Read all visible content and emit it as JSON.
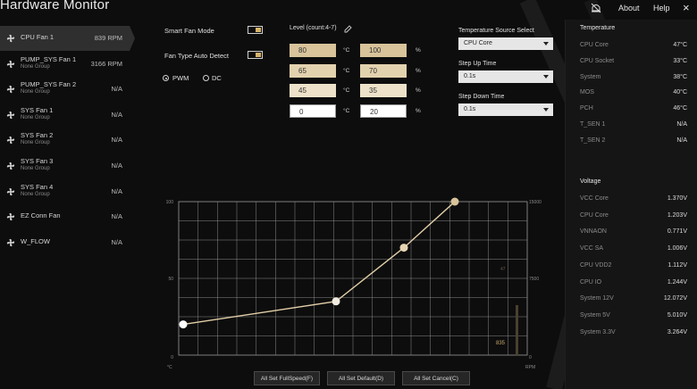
{
  "app": {
    "title": "Hardware Monitor",
    "about": "About",
    "help": "Help",
    "close": "×"
  },
  "fans": [
    {
      "name": "CPU Fan 1",
      "group": "",
      "value": "839 RPM",
      "active": true
    },
    {
      "name": "PUMP_SYS Fan 1",
      "group": "None Group",
      "value": "3166 RPM"
    },
    {
      "name": "PUMP_SYS Fan 2",
      "group": "None Group",
      "value": "N/A"
    },
    {
      "name": "SYS Fan 1",
      "group": "None Group",
      "value": "N/A"
    },
    {
      "name": "SYS Fan 2",
      "group": "None Group",
      "value": "N/A"
    },
    {
      "name": "SYS Fan 3",
      "group": "None Group",
      "value": "N/A"
    },
    {
      "name": "SYS Fan 4",
      "group": "None Group",
      "value": "N/A"
    },
    {
      "name": "EZ Conn Fan",
      "group": "",
      "value": "N/A"
    },
    {
      "name": "W_FLOW",
      "group": "",
      "value": "N/A"
    }
  ],
  "controls": {
    "smart_fan_mode": "Smart Fan Mode",
    "fan_type_auto_detect": "Fan Type Auto Detect",
    "pwm": "PWM",
    "dc": "DC",
    "level_label": "Level (count:4-7)"
  },
  "levels": [
    {
      "temp": "80",
      "temp_unit": "°C",
      "pct": "100",
      "pct_unit": "%"
    },
    {
      "temp": "65",
      "temp_unit": "°C",
      "pct": "70",
      "pct_unit": "%"
    },
    {
      "temp": "45",
      "temp_unit": "°C",
      "pct": "35",
      "pct_unit": "%"
    },
    {
      "temp": "0",
      "temp_unit": "°C",
      "pct": "20",
      "pct_unit": "%"
    }
  ],
  "level_colors": [
    "#d8c39a",
    "#e3d2ae",
    "#ede2c9",
    "#ffffff"
  ],
  "dropdowns": {
    "temp_source_label": "Temperature Source Select",
    "temp_source_value": "CPU Core",
    "step_up_label": "Step Up Time",
    "step_up_value": "0.1s",
    "step_down_label": "Step Down Time",
    "step_down_value": "0.1s"
  },
  "chart_data": {
    "type": "line",
    "x": [
      0,
      45,
      65,
      80
    ],
    "y": [
      20,
      35,
      70,
      100
    ],
    "xlim": [
      0,
      100
    ],
    "ylim": [
      0,
      100
    ],
    "y_ticks_left": [
      "100",
      "50",
      "0"
    ],
    "y_ticks_right": [
      "15000",
      "7500",
      "0"
    ],
    "x_unit_label": "°C",
    "right_unit_label": "RPM",
    "current_rpm_label": "835",
    "current_temp_label": "47",
    "grid": true,
    "line_color": "#e3cfa8"
  },
  "buttons": {
    "full_speed": "All Set FullSpeed(F)",
    "default": "All Set Default(D)",
    "cancel": "All Set Cancel(C)"
  },
  "temperature": {
    "title": "Temperature",
    "items": [
      {
        "label": "CPU Core",
        "value": "47°C"
      },
      {
        "label": "CPU Socket",
        "value": "33°C"
      },
      {
        "label": "System",
        "value": "38°C"
      },
      {
        "label": "MOS",
        "value": "40°C"
      },
      {
        "label": "PCH",
        "value": "46°C"
      },
      {
        "label": "T_SEN 1",
        "value": "N/A"
      },
      {
        "label": "T_SEN 2",
        "value": "N/A"
      }
    ]
  },
  "voltage": {
    "title": "Voltage",
    "items": [
      {
        "label": "VCC Core",
        "value": "1.370V"
      },
      {
        "label": "CPU Core",
        "value": "1.203V"
      },
      {
        "label": "VNNAON",
        "value": "0.771V"
      },
      {
        "label": "VCC SA",
        "value": "1.006V"
      },
      {
        "label": "CPU VDD2",
        "value": "1.112V"
      },
      {
        "label": "CPU IO",
        "value": "1.244V"
      },
      {
        "label": "System 12V",
        "value": "12.072V"
      },
      {
        "label": "System 5V",
        "value": "5.010V"
      },
      {
        "label": "System 3.3V",
        "value": "3.264V"
      }
    ]
  }
}
